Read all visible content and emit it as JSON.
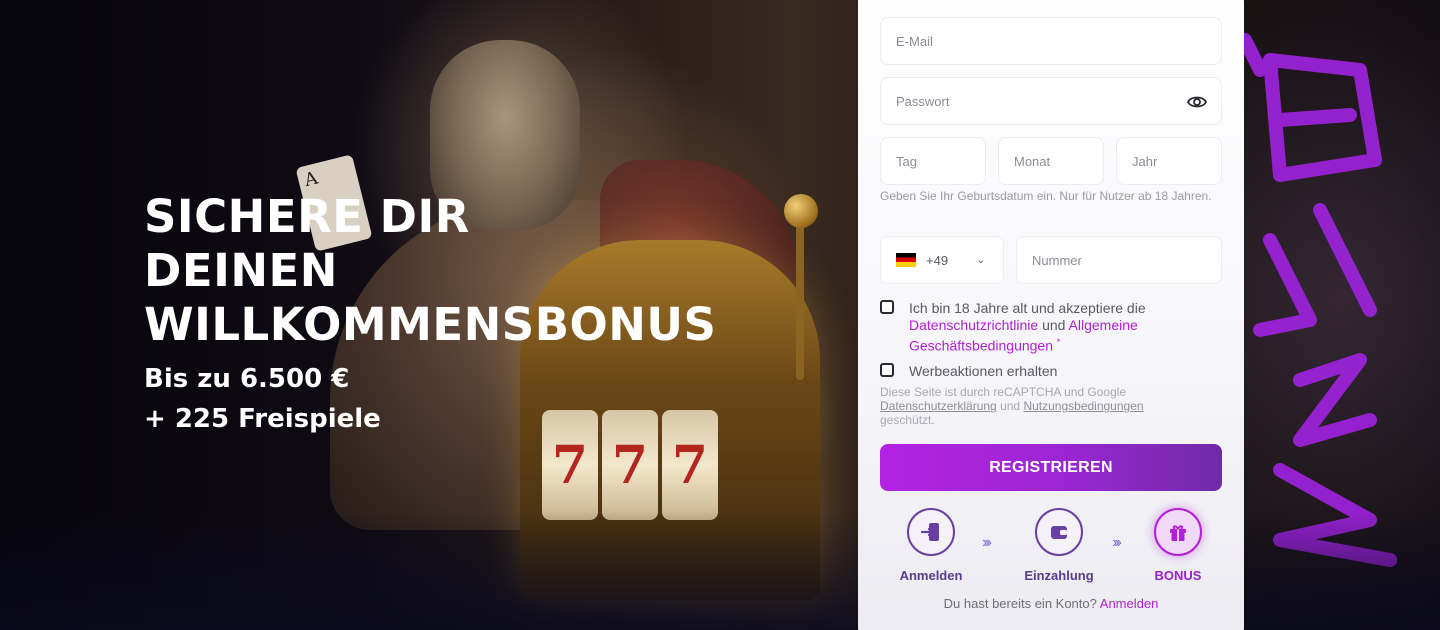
{
  "hero": {
    "headline_lines": [
      "SICHERE DIR",
      "DEINEN",
      "WILLKOMMENSBONUS"
    ],
    "bonus_amount": "Bis zu 6.500 €",
    "free_spins": "+ 225 Freispiele"
  },
  "form": {
    "email_placeholder": "E-Mail",
    "password_placeholder": "Passwort",
    "day_placeholder": "Tag",
    "month_placeholder": "Monat",
    "year_placeholder": "Jahr",
    "birthdate_hint": "Geben Sie Ihr Geburtsdatum ein. Nur für Nutzer ab 18 Jahren.",
    "country_code": "+49",
    "phone_placeholder": "Nummer",
    "terms_text_1": "Ich bin 18 Jahre alt und akzeptiere die",
    "privacy_link": "Datenschutzrichtlinie",
    "terms_and": "und",
    "gtc_link": "Allgemeine Geschäftsbedingungen",
    "required_mark": "*",
    "promo_label": "Werbeaktionen erhalten",
    "recaptcha_text_1": "Diese Seite ist durch reCAPTCHA und Google",
    "recaptcha_privacy": "Datenschutzerklärung",
    "recaptcha_and": "und",
    "recaptcha_terms": "Nutzungsbedingungen",
    "recaptcha_text_2": "geschützt.",
    "register_button": "REGISTRIEREN"
  },
  "steps": [
    {
      "label": "Anmelden",
      "icon": "login-door-icon",
      "active": false
    },
    {
      "label": "Einzahlung",
      "icon": "wallet-icon",
      "active": false
    },
    {
      "label": "BONUS",
      "icon": "gift-icon",
      "active": true
    }
  ],
  "footer": {
    "have_account": "Du hast bereits ein Konto?",
    "login_link": "Anmelden"
  },
  "colors": {
    "accent": "#b31fd6",
    "button_start": "#b422e3",
    "button_end": "#6f2aa8",
    "step_border": "#6a3fa3"
  }
}
